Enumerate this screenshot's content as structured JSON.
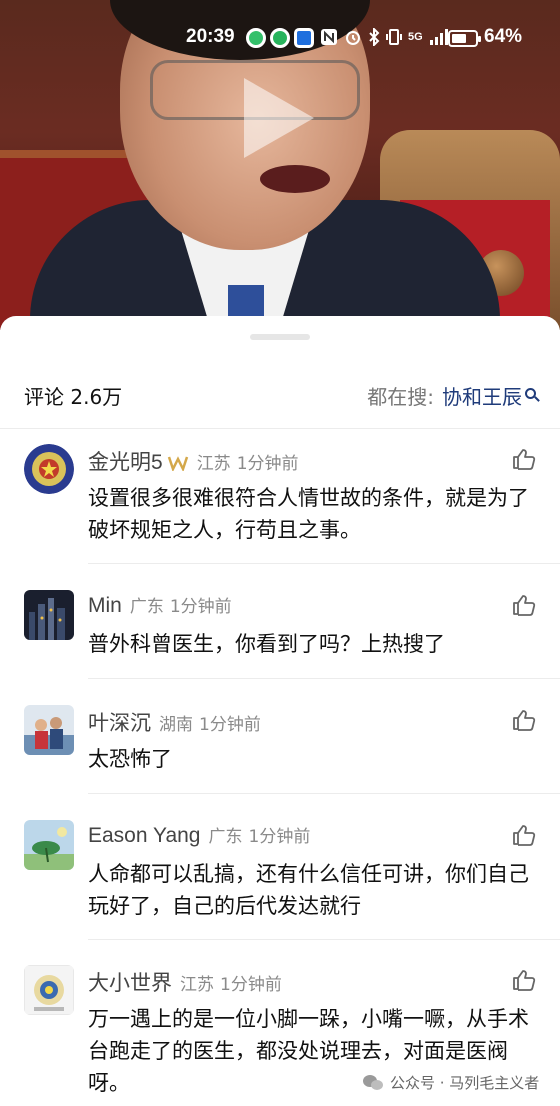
{
  "status_bar": {
    "time": "20:39",
    "network": "5G",
    "battery_level": 0.64,
    "battery_text": "64%"
  },
  "video": {
    "play_icon": "play-icon"
  },
  "comments_header": {
    "count_label": "评论 2.6万",
    "search_label": "都在搜:",
    "search_keyword": "协和王辰"
  },
  "comments": [
    {
      "name": "金光明5",
      "region": "江苏",
      "time": "1分钟前",
      "text": "设置很多很难很符合人情世故的条件，就是为了破坏规矩之人，行苟且之事。"
    },
    {
      "name": "Min",
      "region": "广东",
      "time": "1分钟前",
      "text": "普外科曾医生，你看到了吗？上热搜了"
    },
    {
      "name": "叶深沉",
      "region": "湖南",
      "time": "1分钟前",
      "text": "太恐怖了"
    },
    {
      "name": "Eason Yang",
      "region": "广东",
      "time": "1分钟前",
      "text": "人命都可以乱搞，还有什么信任可讲，你们自己玩好了，自己的后代发达就行"
    },
    {
      "name": "大小世界",
      "region": "江苏",
      "time": "1分钟前",
      "text": "万一遇上的是一位小脚一跺，小嘴一噘，从手术台跑走了的医生，都没处说理去，对面是医阀呀。"
    }
  ],
  "watermark": {
    "text": "公众号 · 马列毛主义者"
  }
}
